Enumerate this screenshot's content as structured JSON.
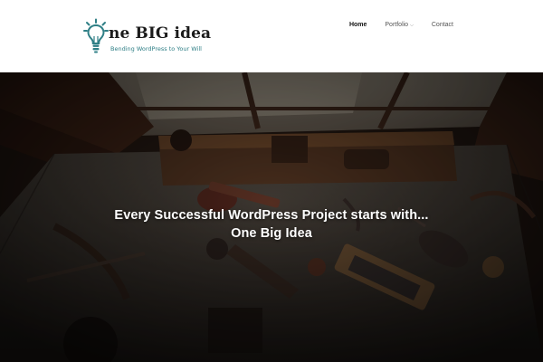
{
  "brand": {
    "logo_icon": "lightbulb-icon",
    "title": "ne BIG idea",
    "tagline": "Bending WordPress to Your Will",
    "accent_color": "#2f7f86"
  },
  "nav": {
    "items": [
      {
        "label": "Home",
        "active": true
      },
      {
        "label": "Portfolio",
        "has_submenu": true,
        "submenu_icon": "chevron-down-icon"
      },
      {
        "label": "Contact"
      }
    ]
  },
  "hero": {
    "line1": "Every Successful WordPress Project starts with...",
    "line2": "One Big Idea",
    "background": "dark workbench with vintage woodworking tools"
  }
}
